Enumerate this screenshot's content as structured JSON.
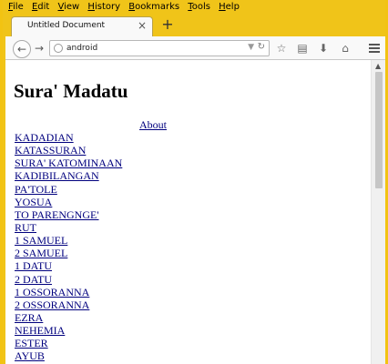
{
  "menubar": [
    "File",
    "Edit",
    "View",
    "History",
    "Bookmarks",
    "Tools",
    "Help"
  ],
  "tab": {
    "title": "Untitled Document",
    "close": "×"
  },
  "newtab": "+",
  "navbar": {
    "url": "android"
  },
  "page": {
    "heading": "Sura' Madatu",
    "about": "About",
    "books": [
      "KADADIAN",
      "KATASSURAN",
      "SURA' KATOMINAAN",
      "KADIBILANGAN",
      "PA'TOLE",
      "YOSUA",
      "TO PARENGNGE'",
      "RUT",
      "1 SAMUEL",
      "2 SAMUEL",
      "1 DATU",
      "2 DATU",
      "1 OSSORANNA",
      "2 OSSORANNA",
      "EZRA",
      "NEHEMIA",
      "ESTER",
      "AYUB"
    ]
  },
  "colors": {
    "chrome": "#f0c419",
    "link": "#00007e"
  }
}
